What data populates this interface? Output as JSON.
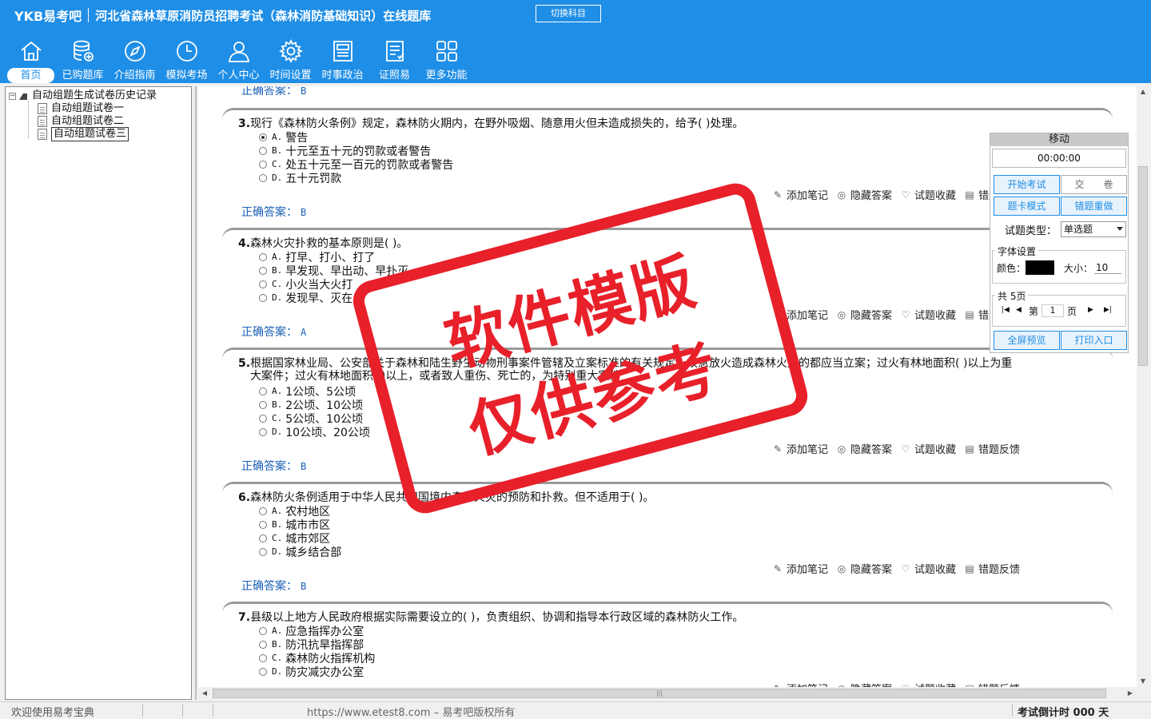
{
  "header": {
    "brand": "YKB易考吧",
    "title": "河北省森林草原消防员招聘考试（森林消防基础知识）在线题库",
    "switch_label": "切换科目"
  },
  "toolbar": [
    {
      "label": "首页",
      "icon": "home-icon"
    },
    {
      "label": "已购题库",
      "icon": "database-icon"
    },
    {
      "label": "介绍指南",
      "icon": "compass-icon"
    },
    {
      "label": "模拟考场",
      "icon": "clock-icon"
    },
    {
      "label": "个人中心",
      "icon": "user-icon"
    },
    {
      "label": "时间设置",
      "icon": "gear-icon"
    },
    {
      "label": "时事政治",
      "icon": "newspaper-icon"
    },
    {
      "label": "证照易",
      "icon": "certificate-icon"
    },
    {
      "label": "更多功能",
      "icon": "grid-icon"
    }
  ],
  "tree": {
    "root": "自动组题生成试卷历史记录",
    "expander": "−",
    "items": [
      "自动组题试卷一",
      "自动组题试卷二",
      "自动组题试卷三"
    ]
  },
  "partial_answer": {
    "label": "正确答案：",
    "value": "B"
  },
  "actions": {
    "note": "添加笔记",
    "hide": "隐藏答案",
    "fav": "试题收藏",
    "report": "错题反馈"
  },
  "questions": [
    {
      "num": "3.",
      "text": "现行《森林防火条例》规定，森林防火期内，在野外吸烟、随意用火但未造成损失的，给予( )处理。",
      "options": [
        {
          "label": "A.",
          "text": "警告",
          "selected": true
        },
        {
          "label": "B.",
          "text": "十元至五十元的罚款或者警告"
        },
        {
          "label": "C.",
          "text": "处五十元至一百元的罚款或者警告"
        },
        {
          "label": "D.",
          "text": "五十元罚款"
        }
      ],
      "answer_label": "正确答案：",
      "answer": "B"
    },
    {
      "num": "4.",
      "text": "森林火灾扑救的基本原则是( )。",
      "options": [
        {
          "label": "A.",
          "text": "打早、打小、打了"
        },
        {
          "label": "B.",
          "text": "早发现、早出动、早扑灭"
        },
        {
          "label": "C.",
          "text": "小火当大火打"
        },
        {
          "label": "D.",
          "text": "发现早、灭在小"
        }
      ],
      "answer_label": "正确答案：",
      "answer": "A"
    },
    {
      "num": "5.",
      "text": "根据国家林业局、公安部关于森林和陆生野生动物刑事案件管辖及立案标准的有关规定，故意放火造成森林火灾的都应当立案；过火有林地面积( )以上为重",
      "text2": "大案件；过火有林地面积( )以上，或者致人重伤、死亡的，为特别重大案件",
      "options": [
        {
          "label": "A.",
          "text": "1公顷、5公顷"
        },
        {
          "label": "B.",
          "text": "2公顷、10公顷"
        },
        {
          "label": "C.",
          "text": "5公顷、10公顷"
        },
        {
          "label": "D.",
          "text": "10公顷、20公顷"
        }
      ],
      "answer_label": "正确答案：",
      "answer": "B"
    },
    {
      "num": "6.",
      "text": "森林防火条例适用于中华人民共和国境内森林火灾的预防和扑救。但不适用于( )。",
      "options": [
        {
          "label": "A.",
          "text": "农村地区"
        },
        {
          "label": "B.",
          "text": "城市市区"
        },
        {
          "label": "C.",
          "text": "城市郊区"
        },
        {
          "label": "D.",
          "text": "城乡结合部"
        }
      ],
      "answer_label": "正确答案：",
      "answer": "B"
    },
    {
      "num": "7.",
      "text": "县级以上地方人民政府根据实际需要设立的( )，负责组织、协调和指导本行政区域的森林防火工作。",
      "options": [
        {
          "label": "A.",
          "text": "应急指挥办公室"
        },
        {
          "label": "B.",
          "text": "防汛抗旱指挥部"
        },
        {
          "label": "C.",
          "text": "森林防火指挥机构"
        },
        {
          "label": "D.",
          "text": "防灾减灾办公室"
        }
      ]
    }
  ],
  "panel": {
    "head": "移动",
    "timer": "00:00:00",
    "start": "开始考试",
    "submit": "交　　卷",
    "card_mode": "题卡模式",
    "redo": "错题重做",
    "type_label": "试题类型：",
    "type_value": "单选题",
    "font_group": "字体设置",
    "color_label": "颜色：",
    "color_value": "#000000",
    "size_label": "大小：",
    "size_value": "10",
    "pages_group": "共 5页",
    "page_prefix": "第",
    "page_value": "1",
    "page_suffix": "页",
    "preview": "全屏预览",
    "print": "打印入口"
  },
  "stamp": {
    "line1": "软件模版",
    "line2": "仅供参考"
  },
  "statusbar": {
    "welcome": "欢迎使用易考宝典",
    "copyright": "https://www.etest8.com – 易考吧版权所有",
    "countdown": "考试倒计时 000 天"
  },
  "colors": {
    "header_blue": "#1f8ee6",
    "stamp_red": "#e8202a",
    "answer_blue": "#1a5fb4"
  }
}
